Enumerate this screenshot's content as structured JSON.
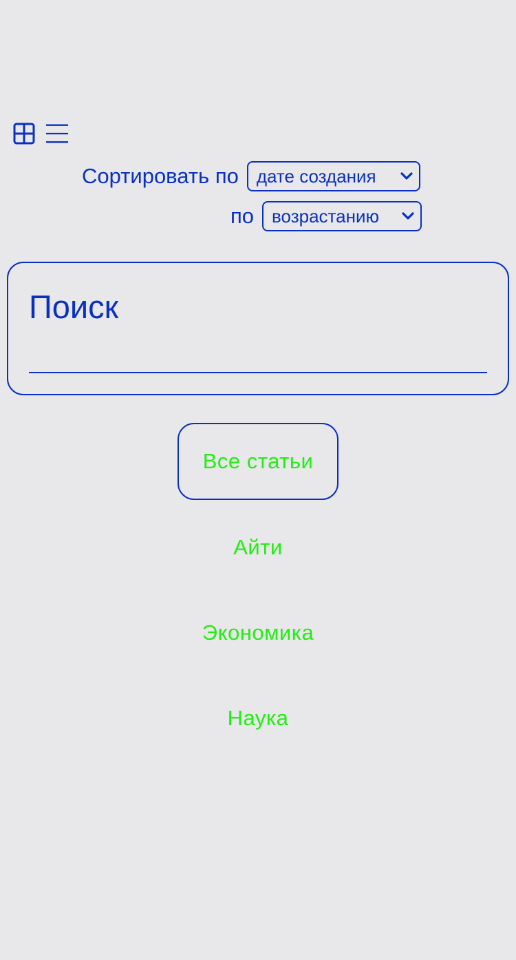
{
  "colors": {
    "background": "#e8e8eb",
    "accent_blue": "#0a30c0",
    "category_green": "#21ee10"
  },
  "view_toggles": [
    {
      "icon": "grid-view-icon",
      "active": true
    },
    {
      "icon": "list-view-icon",
      "active": false
    }
  ],
  "sort": {
    "label": "Сортировать по",
    "field_selected": "дате создания",
    "order_label": "по",
    "order_selected": "возрастанию"
  },
  "search": {
    "placeholder": "Поиск"
  },
  "categories": {
    "all_label": "Все статьи",
    "items": [
      {
        "label": "Айти"
      },
      {
        "label": "Экономика"
      },
      {
        "label": "Наука"
      }
    ]
  }
}
